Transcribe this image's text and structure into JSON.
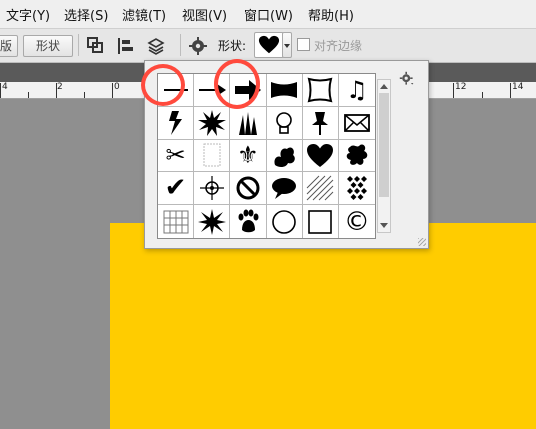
{
  "menubar": {
    "items": [
      "文字(Y)",
      "选择(S)",
      "滤镜(T)",
      "视图(V)",
      "窗口(W)",
      "帮助(H)"
    ]
  },
  "options": {
    "left_button": "版",
    "shape_button": "形状",
    "shape_label": "形状:",
    "align_edges_label": "对齐边缘"
  },
  "ruler": {
    "labels": [
      "4",
      "2",
      "0",
      "12",
      "14"
    ]
  },
  "panel": {
    "grid_rows": 5,
    "grid_cols": 6
  },
  "icons": {
    "selected_shape": "heart-icon",
    "panel_settings": "gear-icon"
  },
  "colors": {
    "document": "#ffcc00",
    "highlight": "#ff4a3d",
    "workspace": "#8f8f8f"
  }
}
